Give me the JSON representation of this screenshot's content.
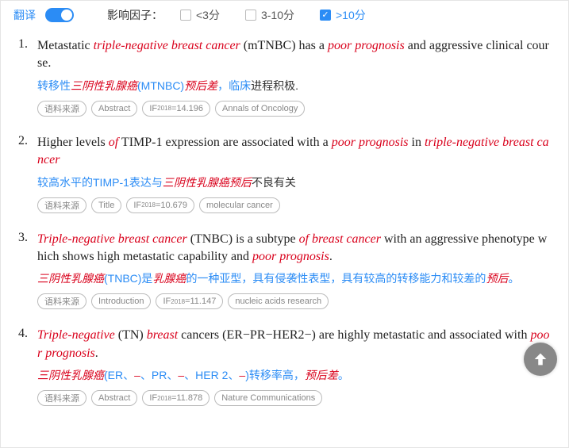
{
  "header": {
    "translate_label": "翻译",
    "if_label": "影响因子：",
    "filters": [
      {
        "label": "<3分",
        "checked": false
      },
      {
        "label": "3-10分",
        "checked": false
      },
      {
        "label": ">10分",
        "checked": true
      }
    ]
  },
  "tag_labels": {
    "source": "语料来源",
    "if_prefix": "IF",
    "if_year": "2018"
  },
  "items": [
    {
      "num": "1.",
      "sentence_parts": [
        {
          "t": "Metastatic ",
          "hl": false
        },
        {
          "t": "triple-negative breast cancer",
          "hl": true
        },
        {
          "t": " (mTNBC) has a ",
          "hl": false
        },
        {
          "t": "poor prognosis",
          "hl": true
        },
        {
          "t": " and aggressive clinical course.",
          "hl": false
        }
      ],
      "translation_parts": [
        {
          "t": "转移性",
          "hl": false
        },
        {
          "t": "三阴性乳腺癌",
          "hl": true
        },
        {
          "t": "(MTNBC)",
          "hl": false
        },
        {
          "t": "预后差",
          "hl": true
        },
        {
          "t": "，临床",
          "hl": false
        },
        {
          "t": "进程积极.",
          "hl": false,
          "black": true
        }
      ],
      "section": "Abstract",
      "if_value": "=14.196",
      "journal": "Annals of Oncology"
    },
    {
      "num": "2.",
      "sentence_parts": [
        {
          "t": "Higher levels ",
          "hl": false
        },
        {
          "t": "of",
          "hl": true
        },
        {
          "t": " TIMP-1 expression are associated with a ",
          "hl": false
        },
        {
          "t": "poor prognosis",
          "hl": true
        },
        {
          "t": " in ",
          "hl": false
        },
        {
          "t": "triple-negative breast cancer",
          "hl": true
        }
      ],
      "translation_parts": [
        {
          "t": "较高水平的TIMP-1表达与",
          "hl": false
        },
        {
          "t": "三阴性乳腺癌预后",
          "hl": true
        },
        {
          "t": "不良有关",
          "hl": false,
          "black": true
        }
      ],
      "section": "Title",
      "if_value": "=10.679",
      "journal": "molecular cancer"
    },
    {
      "num": "3.",
      "sentence_parts": [
        {
          "t": "Triple-negative breast cancer",
          "hl": true
        },
        {
          "t": " (TNBC) is a subtype ",
          "hl": false
        },
        {
          "t": "of breast cancer",
          "hl": true
        },
        {
          "t": " with an aggressive phenotype which shows high metastatic capability and ",
          "hl": false
        },
        {
          "t": "poor prognosis",
          "hl": true
        },
        {
          "t": ".",
          "hl": false
        }
      ],
      "translation_parts": [
        {
          "t": "三阴性乳腺癌",
          "hl": true
        },
        {
          "t": "(TNBC)是",
          "hl": false
        },
        {
          "t": "乳腺癌",
          "hl": true
        },
        {
          "t": "的一种亚型，具有侵袭性表型，具有较高的转移能力和较差的",
          "hl": false
        },
        {
          "t": "预后",
          "hl": true
        },
        {
          "t": "。",
          "hl": false
        }
      ],
      "section": "Introduction",
      "if_value": "=11.147",
      "journal": "nucleic acids research"
    },
    {
      "num": "4.",
      "sentence_parts": [
        {
          "t": "Triple-negative",
          "hl": true
        },
        {
          "t": " (TN) ",
          "hl": false
        },
        {
          "t": "breast",
          "hl": true
        },
        {
          "t": " cancers (ER−PR−HER2−) are highly metastatic and associated with ",
          "hl": false
        },
        {
          "t": "poor prognosis",
          "hl": true
        },
        {
          "t": ".",
          "hl": false
        }
      ],
      "translation_parts": [
        {
          "t": "三阴性乳腺癌",
          "hl": true
        },
        {
          "t": "(ER、",
          "hl": false
        },
        {
          "t": "–",
          "hl": true
        },
        {
          "t": "、PR、",
          "hl": false
        },
        {
          "t": "–",
          "hl": true
        },
        {
          "t": "、HER 2、",
          "hl": false
        },
        {
          "t": "–",
          "hl": true
        },
        {
          "t": ")转移率高，",
          "hl": false
        },
        {
          "t": "预后差",
          "hl": true
        },
        {
          "t": "。",
          "hl": false
        }
      ],
      "section": "Abstract",
      "if_value": "=11.878",
      "journal": "Nature Communications"
    }
  ]
}
